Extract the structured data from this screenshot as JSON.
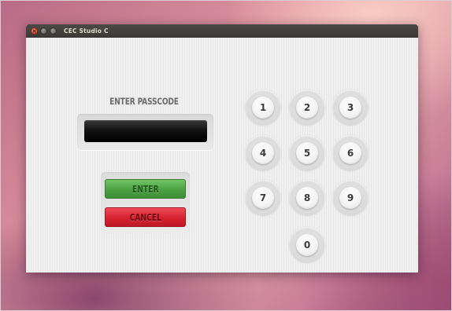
{
  "window": {
    "title": "CEC Studio C"
  },
  "passcode": {
    "label": "ENTER PASSCODE",
    "value": ""
  },
  "buttons": {
    "enter": "ENTER",
    "cancel": "CANCEL"
  },
  "keypad": {
    "keys": [
      "1",
      "2",
      "3",
      "4",
      "5",
      "6",
      "7",
      "8",
      "9",
      "0"
    ]
  },
  "icons": {
    "close": "close-icon",
    "minimize": "minimize-icon",
    "maximize": "maximize-icon"
  },
  "colors": {
    "enter_button": "#4ca243",
    "cancel_button": "#d6222f",
    "display": "#000000",
    "titlebar": "#3e3d39",
    "window_background": "#f0f0f0"
  }
}
